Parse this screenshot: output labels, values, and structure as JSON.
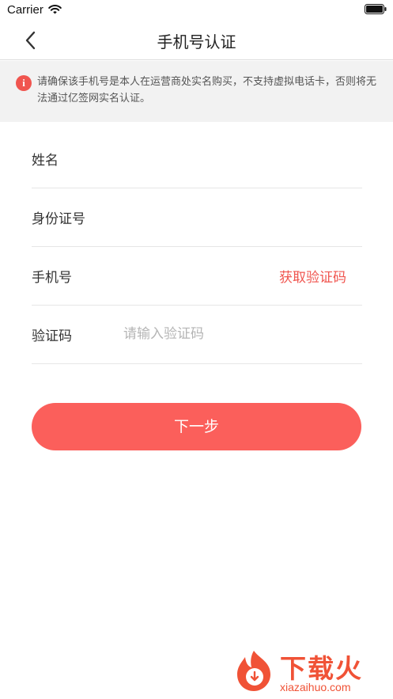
{
  "status_bar": {
    "carrier": "Carrier",
    "wifi_icon": "wifi-icon",
    "battery_icon": "battery-icon"
  },
  "nav": {
    "title": "手机号认证",
    "back_icon": "chevron-left-icon"
  },
  "notice": {
    "icon": "exclamation-circle-icon",
    "text": "请确保该手机号是本人在运营商处实名购买，不支持虚拟电话卡，否则将无法通过亿签网实名认证。"
  },
  "form": {
    "name_label": "姓名",
    "id_label": "身份证号",
    "phone_label": "手机号",
    "get_code_label": "获取验证码",
    "code_label": "验证码",
    "code_value": "",
    "code_placeholder": "请输入验证码"
  },
  "next_button": {
    "label": "下一步"
  },
  "watermark": {
    "title": "下载火",
    "subtitle": "xiazaihuo.com"
  },
  "colors": {
    "accent": "#fb5f5b",
    "link": "#f0554f",
    "notice_bg": "#f2f2f2",
    "placeholder": "#b5b5b5"
  }
}
